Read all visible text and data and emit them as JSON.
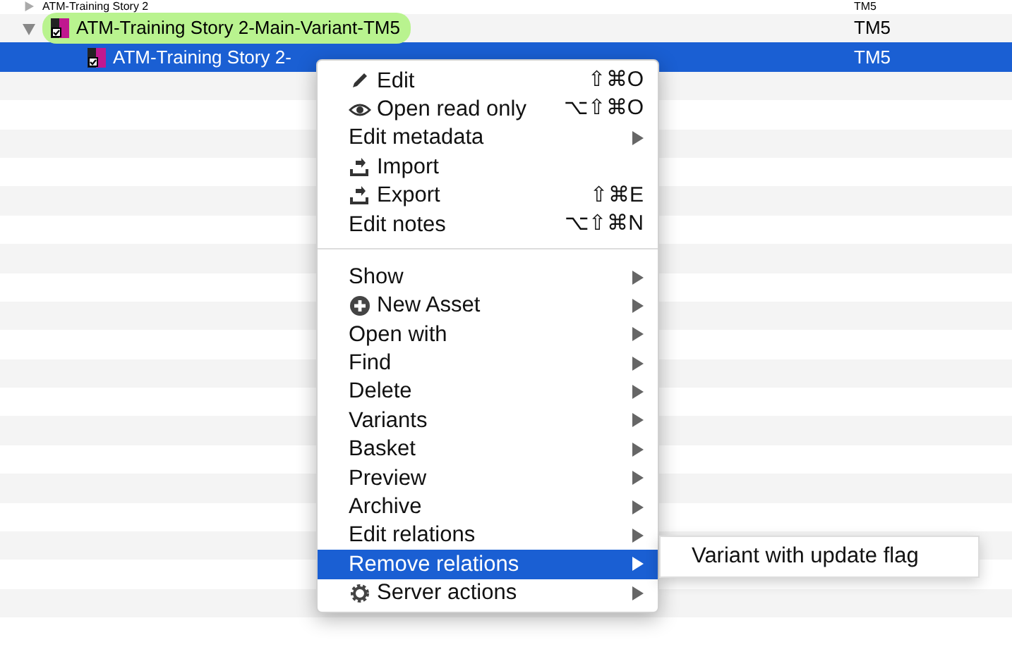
{
  "tree": {
    "rows": [
      {
        "label": "ATM-Training Story 2",
        "column_2": "TM5",
        "expanded": false,
        "selected": false,
        "children": []
      },
      {
        "label": "ATM-Training Story 2-Main-Variant-TM5",
        "column_2": "TM5",
        "expanded": true,
        "selected": false,
        "color": "#b9f38f",
        "children": [
          {
            "label": "ATM-Training Story 2-",
            "column_2": "TM5",
            "selected": true
          }
        ]
      }
    ]
  },
  "context_menu": {
    "items": [
      {
        "kind": "item",
        "label": "Edit",
        "shortcut": "⇧⌘O",
        "submenu": false,
        "selected": false
      },
      {
        "kind": "item",
        "label": "Open read only",
        "shortcut": "⌥⇧⌘O",
        "submenu": false,
        "selected": false
      },
      {
        "kind": "item",
        "label": "Edit metadata",
        "submenu": true,
        "selected": false
      },
      {
        "kind": "item",
        "label": "Import",
        "submenu": false,
        "selected": false
      },
      {
        "kind": "item",
        "label": "Export",
        "shortcut": "⇧⌘E",
        "submenu": false,
        "selected": false
      },
      {
        "kind": "item",
        "label": "Edit notes",
        "shortcut": "⌥⇧⌘N",
        "submenu": false,
        "selected": false
      },
      {
        "kind": "separator"
      },
      {
        "kind": "item",
        "label": "Show",
        "submenu": true,
        "selected": false
      },
      {
        "kind": "item",
        "label": "New Asset",
        "submenu": true,
        "selected": false
      },
      {
        "kind": "item",
        "label": "Open with",
        "submenu": true,
        "selected": false
      },
      {
        "kind": "item",
        "label": "Find",
        "submenu": true,
        "selected": false
      },
      {
        "kind": "item",
        "label": "Delete",
        "submenu": true,
        "selected": false
      },
      {
        "kind": "item",
        "label": "Variants",
        "submenu": true,
        "selected": false
      },
      {
        "kind": "item",
        "label": "Basket",
        "submenu": true,
        "selected": false
      },
      {
        "kind": "item",
        "label": "Preview",
        "submenu": true,
        "selected": false
      },
      {
        "kind": "item",
        "label": "Archive",
        "submenu": true,
        "selected": false
      },
      {
        "kind": "item",
        "label": "Edit relations",
        "submenu": true,
        "selected": false
      },
      {
        "kind": "item",
        "label": "Remove relations",
        "submenu": true,
        "selected": true,
        "submenu_items": [
          "Variant with update flag"
        ]
      },
      {
        "kind": "item",
        "label": "Server actions",
        "submenu": true,
        "selected": false
      }
    ]
  }
}
